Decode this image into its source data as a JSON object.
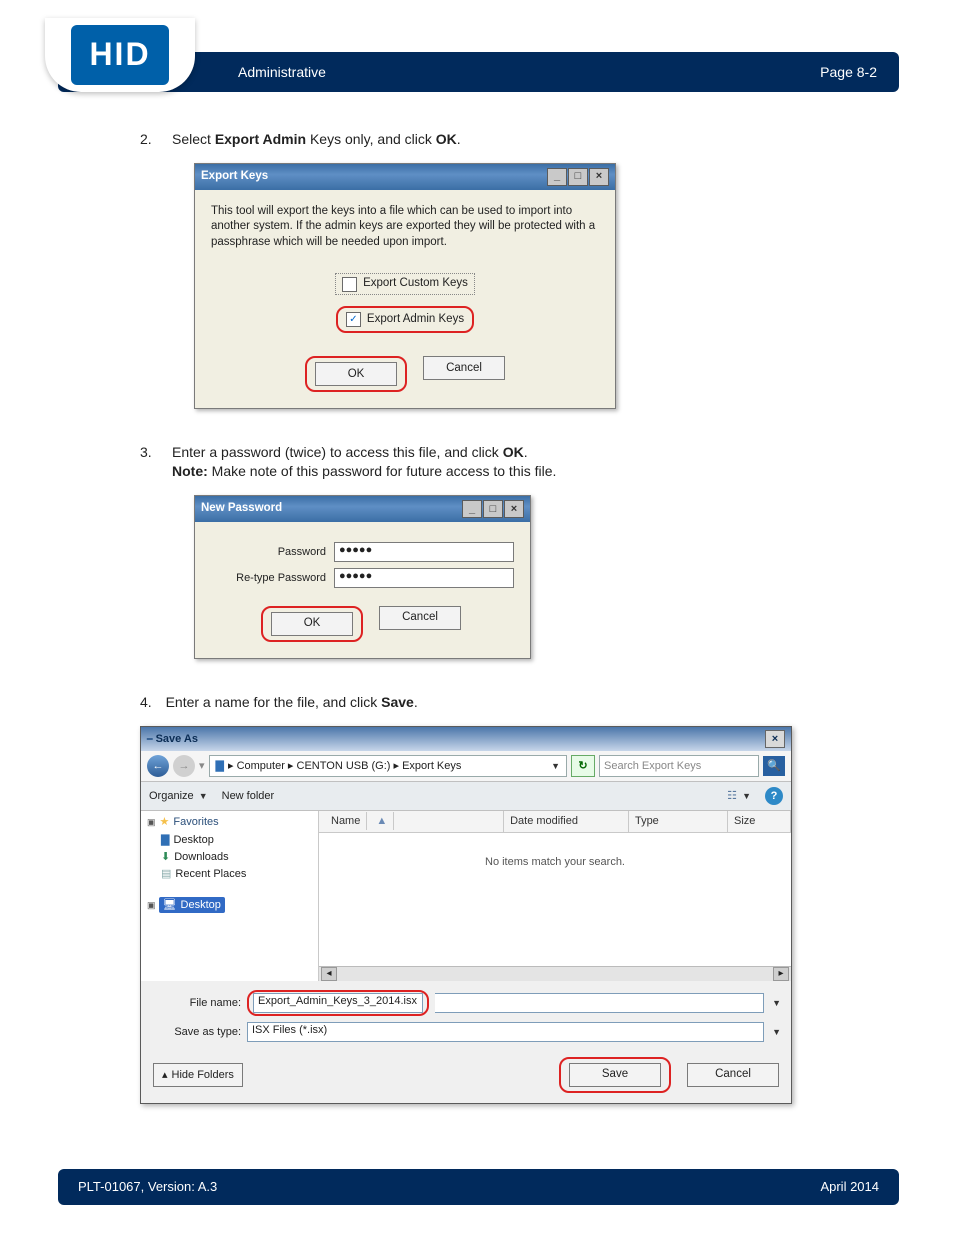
{
  "header": {
    "section": "Administrative",
    "page_label": "Page 8-2",
    "logo_text": "HID"
  },
  "footer": {
    "doc_id": "PLT-01067, Version: A.3",
    "date": "April 2014"
  },
  "steps": {
    "s2": {
      "num": "2.",
      "pre": "Select ",
      "b1": "Export Admin",
      "mid": " Keys only, and click ",
      "b2": "OK",
      "post": "."
    },
    "s3": {
      "num": "3.",
      "l1a": "Enter a password (twice) to access this file, and click ",
      "l1b": "OK",
      "l1c": ".",
      "l2a": "Note:",
      "l2b": " Make note of this password for future access to this file."
    },
    "s4": {
      "num": "4.",
      "pre": "Enter a name for the file, and click ",
      "b": "Save",
      "post": "."
    }
  },
  "export_dialog": {
    "title": "Export Keys",
    "desc": "This tool will export the keys into a file which can be used to import into another system. If the admin keys are exported they will be protected with a passphrase which will be needed upon import.",
    "opt1": "Export Custom Keys",
    "opt2": "Export Admin Keys",
    "ok": "OK",
    "cancel": "Cancel"
  },
  "password_dialog": {
    "title": "New Password",
    "pw_label": "Password",
    "pw_val": "●●●●●",
    "pw2_label": "Re-type Password",
    "pw2_val": "●●●●●",
    "ok": "OK",
    "cancel": "Cancel"
  },
  "saveas": {
    "title": "Save As",
    "crumb1": "Computer",
    "crumb2": "CENTON USB (G:)",
    "crumb3": "Export Keys",
    "search_placeholder": "Search Export Keys",
    "organize": "Organize",
    "newfolder": "New folder",
    "col_name": "Name",
    "col_date": "Date modified",
    "col_type": "Type",
    "col_size": "Size",
    "favorites": "Favorites",
    "fav_items": {
      "desktop": "Desktop",
      "downloads": "Downloads",
      "recent": "Recent Places"
    },
    "desktop_node": "Desktop",
    "empty": "No items match your search.",
    "filename_label": "File name:",
    "filename_value": "Export_Admin_Keys_3_2014.isx",
    "type_label": "Save as type:",
    "type_value": "ISX Files (*.isx)",
    "hide": "Hide Folders",
    "save": "Save",
    "cancel": "Cancel"
  }
}
